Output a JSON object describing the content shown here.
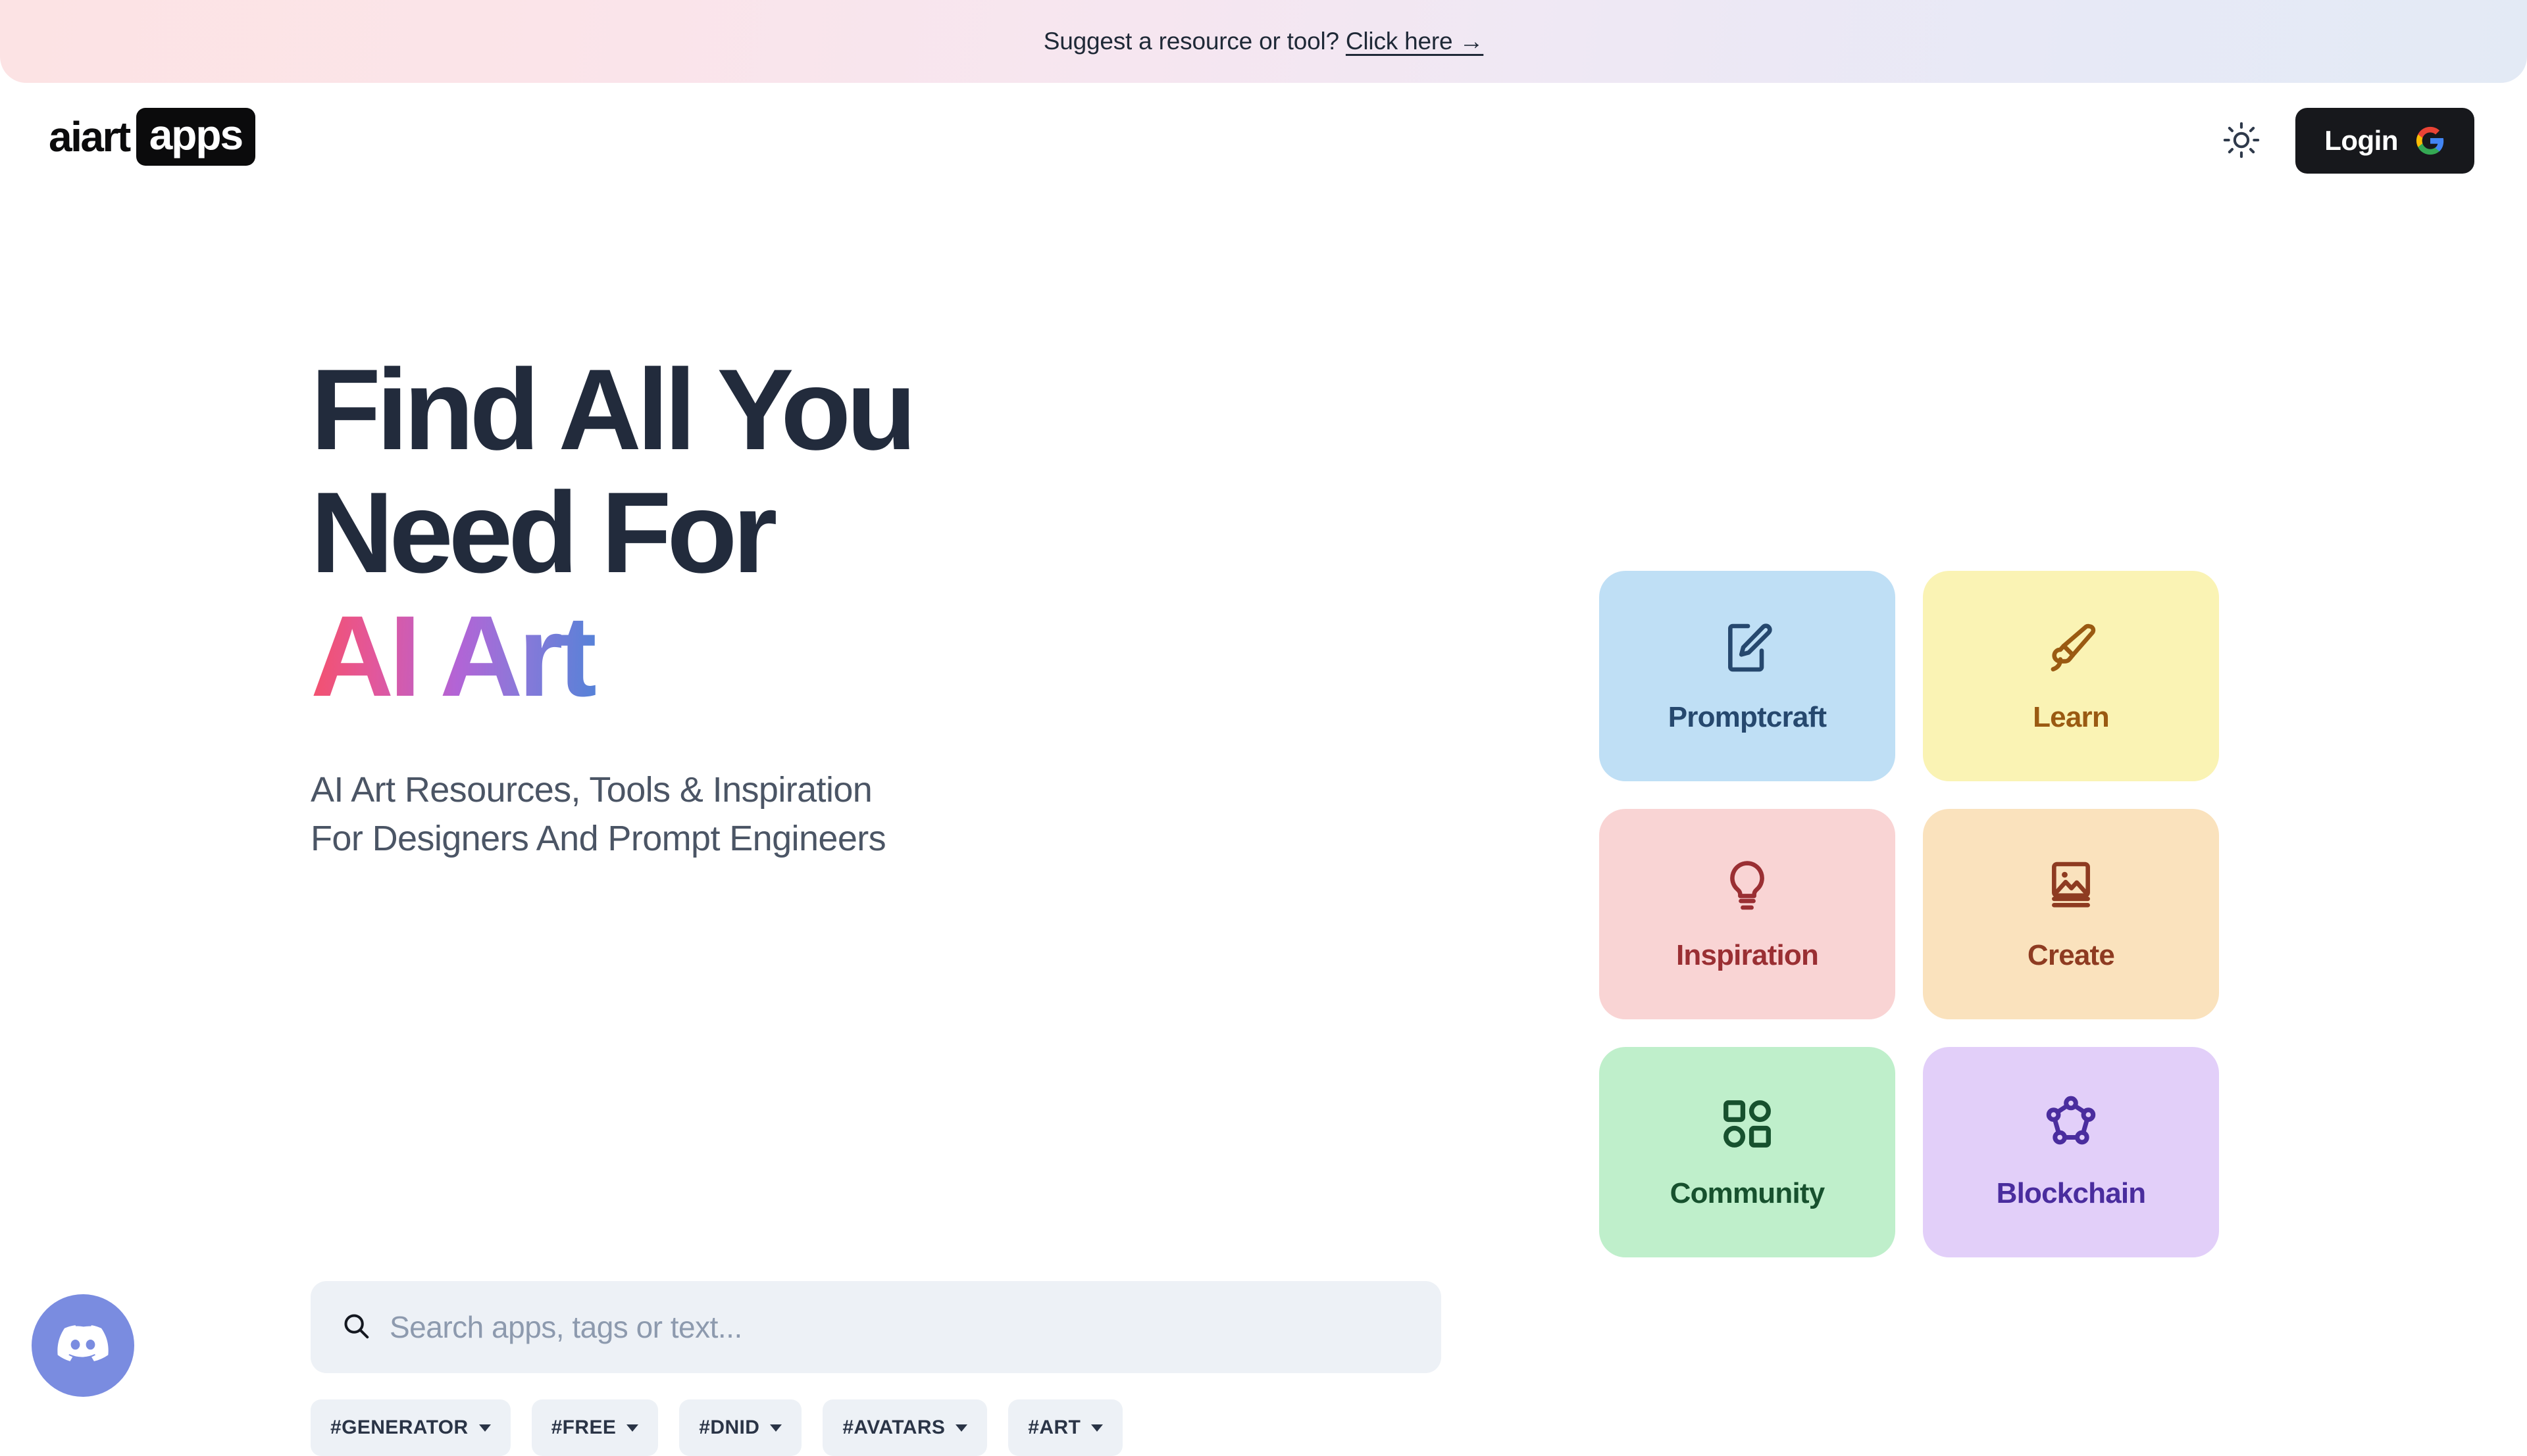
{
  "announcement": {
    "text": "Suggest a resource or tool?",
    "link_label": "Click here →"
  },
  "header": {
    "brand_word": "aiart",
    "brand_chip": "apps",
    "theme_toggle_icon": "sun-icon",
    "login_label": "Login",
    "login_provider_icon": "google-g-icon"
  },
  "hero": {
    "line1": "Find All You",
    "line2": "Need For",
    "accent": "AI Art",
    "accent_gradient": [
      "#F4516C",
      "#B264D6",
      "#4F83D8"
    ],
    "sub_line1": "AI Art Resources, Tools & Inspiration",
    "sub_line2": "For Designers And Prompt Engineers"
  },
  "search": {
    "placeholder": "Search apps, tags or text...",
    "value": "",
    "icon": "search-icon"
  },
  "tags": [
    {
      "label": "#GENERATOR"
    },
    {
      "label": "#FREE"
    },
    {
      "label": "#DNID"
    },
    {
      "label": "#AVATARS"
    },
    {
      "label": "#ART"
    }
  ],
  "categories": [
    {
      "label": "Promptcraft",
      "icon": "document-pencil-icon",
      "bg": "#BFDFF5",
      "fg": "#26486E"
    },
    {
      "label": "Learn",
      "icon": "paintbrush-icon",
      "bg": "#FAF3B4",
      "fg": "#9A5A12"
    },
    {
      "label": "Inspiration",
      "icon": "lightbulb-icon",
      "bg": "#F9D4D4",
      "fg": "#9A2F33"
    },
    {
      "label": "Create",
      "icon": "image-book-icon",
      "bg": "#FAE2BD",
      "fg": "#8E3B21"
    },
    {
      "label": "Community",
      "icon": "shapes-grid-icon",
      "bg": "#BFEFCB",
      "fg": "#17512E"
    },
    {
      "label": "Blockchain",
      "icon": "blockchain-nodes-icon",
      "bg": "#E2CFF9",
      "fg": "#4A2D9E"
    }
  ],
  "discord": {
    "icon": "discord-icon",
    "bg": "#7A8CE0"
  }
}
